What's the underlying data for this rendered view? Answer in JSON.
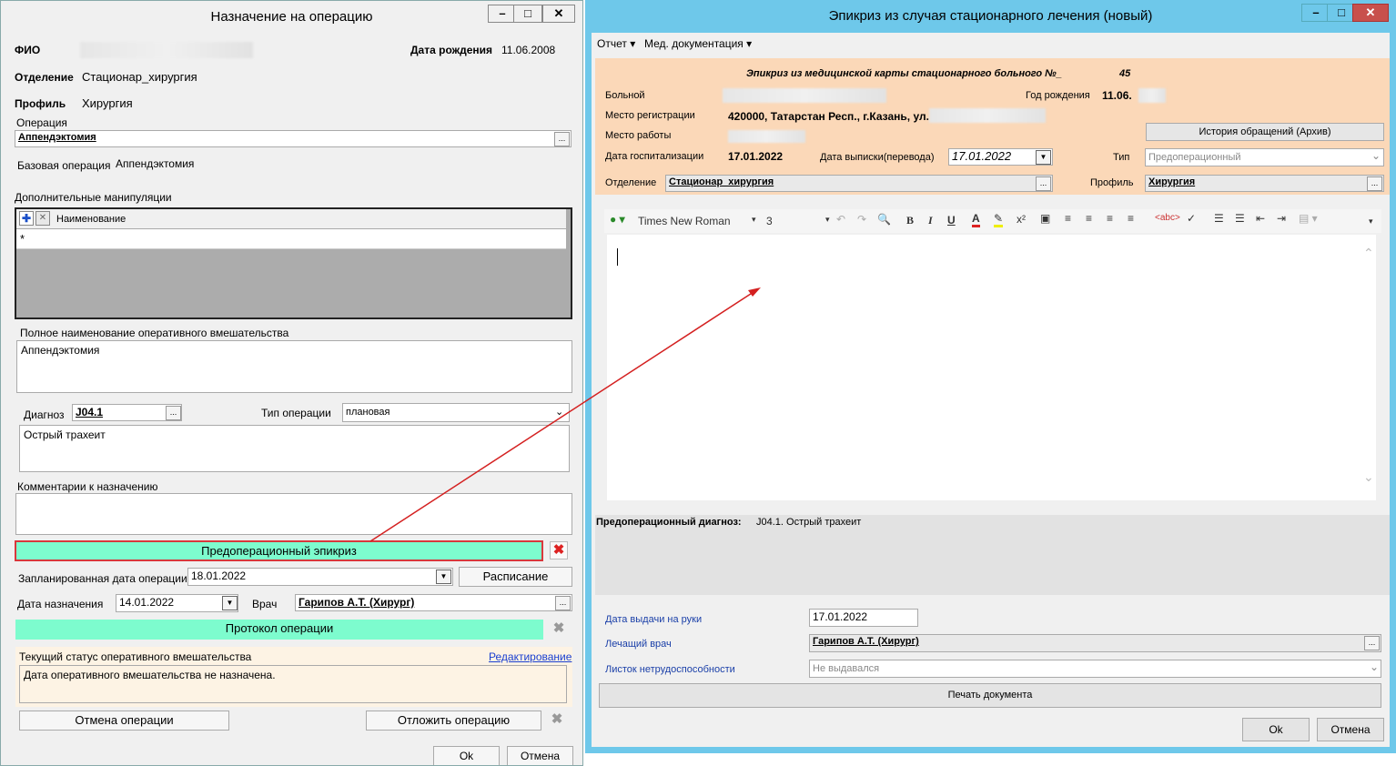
{
  "left_window": {
    "title": "Назначение на операцию",
    "fio_label": "ФИО",
    "dob_label": "Дата рождения",
    "dob_value": "11.06.2008",
    "dept_label": "Отделение",
    "dept_value": "Стационар_хирургия",
    "profile_label": "Профиль",
    "profile_value": "Хирургия",
    "operation_label": "Операция",
    "operation_value": "Аппендэктомия",
    "base_op_label": "Базовая операция",
    "base_op_value": "Аппендэктомия",
    "extra_label": "Дополнительные манипуляции",
    "extra_col": "Наименование",
    "extra_new_row": "*",
    "full_name_label": "Полное наименование оперативного вмешательства",
    "full_name_value": "Аппендэктомия",
    "diag_label": "Диагноз",
    "diag_code": "J04.1",
    "op_type_label": "Тип операции",
    "op_type_value": "плановая",
    "diag_text": "Острый трахеит",
    "comment_label": "Комментарии к назначению",
    "preop_btn": "Предоперационный эпикриз",
    "planned_date_label": "Запланированная дата операции",
    "planned_date_value": "18.01.2022",
    "schedule_btn": "Расписание",
    "assign_date_label": "Дата назначения",
    "assign_date_value": "14.01.2022",
    "doctor_label": "Врач",
    "doctor_value": "Гарипов А.Т. (Хирург)",
    "protocol_btn": "Протокол операции",
    "status_label": "Текущий статус оперативного вмешательства",
    "edit_link": "Редактирование",
    "status_text": "Дата оперативного вмешательства не назначена.",
    "cancel_op_btn": "Отмена операции",
    "postpone_btn": "Отложить операцию",
    "ok_btn": "Ok",
    "cancel_btn": "Отмена"
  },
  "right_window": {
    "title": "Эпикриз из случая стационарного лечения (новый)",
    "menu": [
      "Отчет",
      "Мед. документация"
    ],
    "heading": "Эпикриз из медицинской карты стационарного больного №_",
    "card_number": "45",
    "patient_label": "Больной",
    "birth_year_label": "Год рождения",
    "birth_year_value": "11.06.",
    "reg_label": "Место регистрации",
    "reg_value": "420000, Татарстан Респ., г.Казань, ул.",
    "work_label": "Место работы",
    "history_btn": "История обращений (Архив)",
    "hosp_date_label": "Дата госпитализации",
    "hosp_date_value": "17.01.2022",
    "discharge_label": "Дата выписки(перевода)",
    "discharge_value": "17.01.2022",
    "type_label": "Тип",
    "type_value": "Предоперационный",
    "dept_label": "Отделение",
    "dept_value": "Стационар_хирургия",
    "profile_label": "Профиль",
    "profile_value": "Хирургия",
    "font_name": "Times New Roman",
    "font_size": "3",
    "preop_diag_label": "Предоперационный диагноз:",
    "preop_diag_value": "J04.1. Острый трахеит",
    "issue_date_label": "Дата выдачи на руки",
    "issue_date_value": "17.01.2022",
    "doctor_label": "Лечащий врач",
    "doctor_value": "Гарипов А.Т. (Хирург)",
    "sick_label": "Листок нетрудоспособности",
    "sick_value": "Не выдавался",
    "print_btn": "Печать документа",
    "ok_btn": "Ok",
    "cancel_btn": "Отмена"
  },
  "colors": {
    "accent_green": "#7dfcce",
    "header_peach": "#fbd8b8",
    "title_blue": "#6ec8ea",
    "arrow_red": "#d42020"
  }
}
